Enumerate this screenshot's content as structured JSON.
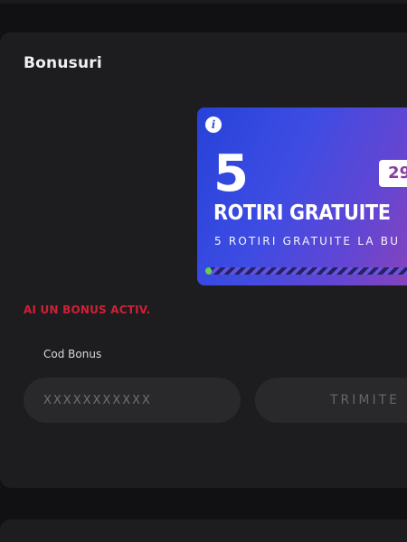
{
  "section": {
    "title": "Bonusuri"
  },
  "bonus_card": {
    "info_icon": "info-icon",
    "count": "5",
    "badge_text": "29",
    "title": "ROTIRI GRATUITE",
    "subtitle": "5 ROTIRI GRATUITE LA BU",
    "progress_fraction": 0.03
  },
  "status": {
    "message": "AI UN BONUS ACTIV."
  },
  "bonus_code": {
    "label": "Cod Bonus",
    "placeholder": "XXXXXXXXXXX",
    "value": "",
    "submit_label": "TRIMITE"
  },
  "colors": {
    "page_background": "#111113",
    "panel_background": "#1d1d1f",
    "input_background": "#29292b",
    "status_red": "#d12035",
    "card_blue": "#2742d9",
    "card_purple": "#8d43b8",
    "progress_green": "#66d14f"
  }
}
